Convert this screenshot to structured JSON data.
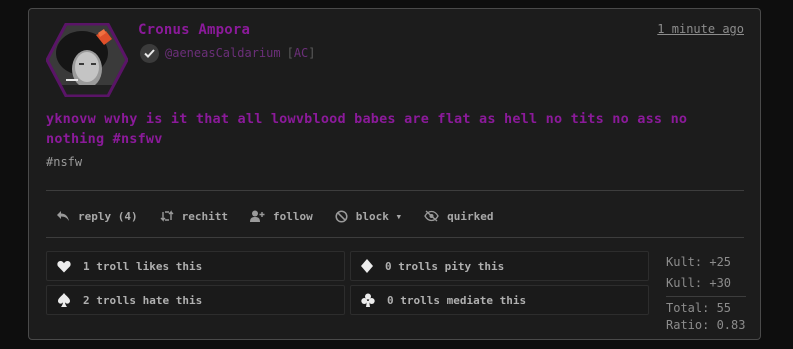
{
  "post": {
    "author": "Cronus Ampora",
    "handle": "@aeneasCaldarium",
    "tag": "AC",
    "timestamp": "1 minute ago",
    "body": "yknovw wvhy is it that all lowvblood babes are flat as hell no tits no ass no nothing #nsfwv",
    "hashtags": "#nsfw"
  },
  "actions": [
    {
      "label": "reply (4)",
      "icon": "reply-icon"
    },
    {
      "label": "rechitt",
      "icon": "rechitt-icon"
    },
    {
      "label": "follow",
      "icon": "follow-icon"
    },
    {
      "label": "block ▾",
      "icon": "block-icon"
    },
    {
      "label": "quirked",
      "icon": "quirked-icon"
    }
  ],
  "reactions": [
    {
      "label": "1 troll likes this",
      "icon": "heart-icon"
    },
    {
      "label": "0 trolls pity this",
      "icon": "diamond-icon"
    },
    {
      "label": "2 trolls hate this",
      "icon": "spade-icon"
    },
    {
      "label": "0 trolls mediate this",
      "icon": "club-icon"
    }
  ],
  "stats": {
    "kult": "Kult: +25",
    "kull": "Kull: +30",
    "total": "Total: 55",
    "ratio": "Ratio: 0.83"
  },
  "colors": {
    "accent": "#8b1a9a",
    "handle": "#6b2f79",
    "background": "#0e0e0e",
    "card": "#1c1c1c"
  }
}
